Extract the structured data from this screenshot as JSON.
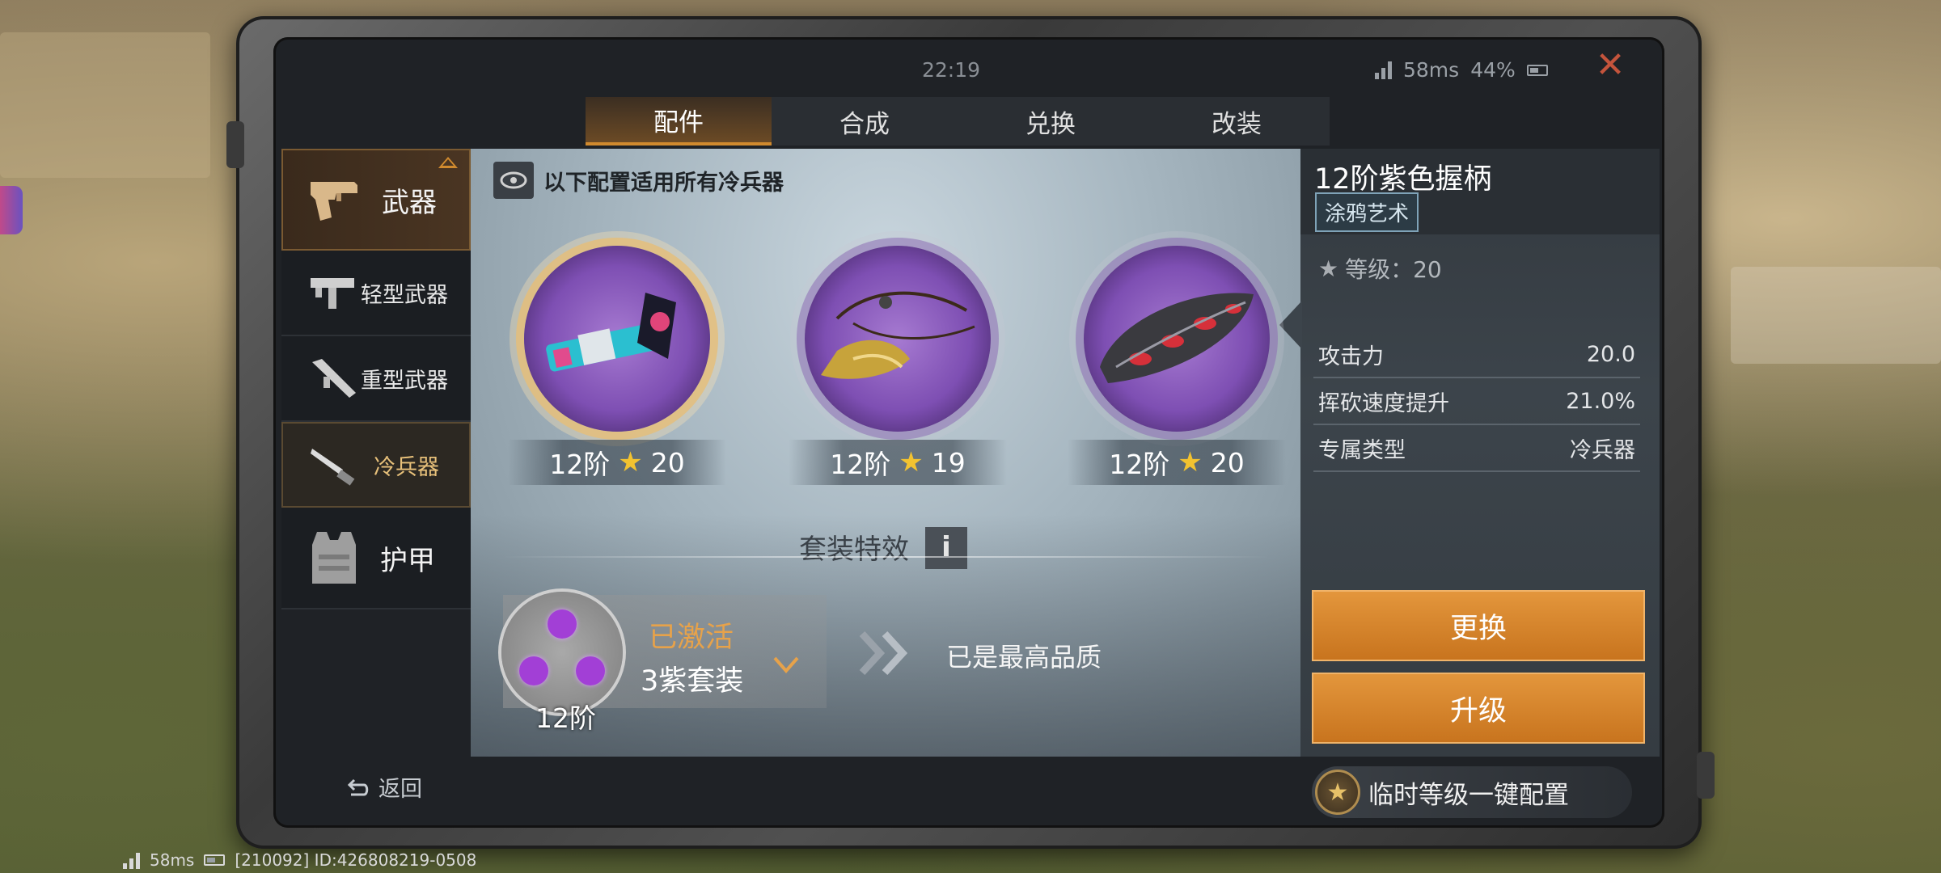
{
  "status": {
    "clock": "22:19",
    "ping": "58ms",
    "battery": "44%"
  },
  "tabs": [
    {
      "label": "配件",
      "active": true
    },
    {
      "label": "合成",
      "active": false
    },
    {
      "label": "兑换",
      "active": false
    },
    {
      "label": "改装",
      "active": false
    }
  ],
  "nav": {
    "weapons": "武器",
    "light_weapons": "轻型武器",
    "heavy_weapons": "重型武器",
    "melee_weapons": "冷兵器",
    "armor": "护甲"
  },
  "notice": "以下配置适用所有冷兵器",
  "items": [
    {
      "tier": "12阶",
      "stars": "20",
      "icon": "tomahawk-icon"
    },
    {
      "tier": "12阶",
      "stars": "19",
      "icon": "tassel-icon"
    },
    {
      "tier": "12阶",
      "stars": "20",
      "icon": "grip-icon"
    }
  ],
  "set_effect": {
    "title": "套装特效",
    "info": "i",
    "state": "已激活",
    "name": "3紫套装",
    "tier": "12阶",
    "max_quality": "已是最高品质"
  },
  "detail": {
    "title": "12阶紫色握柄",
    "tag": "涂鸦艺术",
    "level": "等级：20",
    "stats": [
      {
        "label": "攻击力",
        "value": "20.0"
      },
      {
        "label": "挥砍速度提升",
        "value": "21.0%"
      },
      {
        "label": "专属类型",
        "value": "冷兵器"
      }
    ],
    "replace_label": "更换",
    "upgrade_label": "升级"
  },
  "bottom": {
    "back_label": "返回",
    "quick_config_label": "临时等级一键配置"
  },
  "footer": {
    "ping": "58ms",
    "session": "[210092] ID:426808219-0508"
  },
  "colors": {
    "accent_orange": "#d08a2e",
    "purple_quality": "#7e4fb3",
    "close_red": "#c4543c"
  }
}
